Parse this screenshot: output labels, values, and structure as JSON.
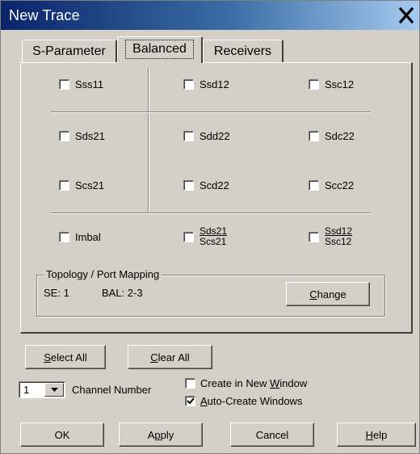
{
  "window": {
    "title": "New Trace"
  },
  "tabs": [
    {
      "label": "S-Parameter",
      "active": false
    },
    {
      "label": "Balanced",
      "active": true
    },
    {
      "label": "Receivers",
      "active": false
    }
  ],
  "params": {
    "sss11": {
      "label": "Sss11",
      "checked": false
    },
    "ssd12": {
      "label": "Ssd12",
      "checked": false
    },
    "ssc12": {
      "label": "Ssc12",
      "checked": false
    },
    "sds21": {
      "label": "Sds21",
      "checked": false
    },
    "sdd22": {
      "label": "Sdd22",
      "checked": false
    },
    "sdc22": {
      "label": "Sdc22",
      "checked": false
    },
    "scs21": {
      "label": "Scs21",
      "checked": false
    },
    "scd22": {
      "label": "Scd22",
      "checked": false
    },
    "scc22": {
      "label": "Scc22",
      "checked": false
    },
    "imbal": {
      "label": "Imbal",
      "checked": false
    },
    "ratio1": {
      "numerator": "Sds21",
      "denominator": "Scs21",
      "checked": false
    },
    "ratio2": {
      "numerator": "Ssd12",
      "denominator": "Ssc12",
      "checked": false
    }
  },
  "topology": {
    "group_title": "Topology / Port Mapping",
    "se": "SE: 1",
    "bal": "BAL: 2-3",
    "change_button": {
      "mnemonic": "C",
      "rest": "hange"
    }
  },
  "select_all": {
    "mnemonic": "S",
    "rest": "elect All"
  },
  "clear_all": {
    "mnemonic": "C",
    "rest": "lear All"
  },
  "channel": {
    "value": "1",
    "label": "Channel Number"
  },
  "create_new_window": {
    "prefix": "Create in New ",
    "mnemonic": "W",
    "rest": "indow",
    "checked": false
  },
  "auto_create": {
    "mnemonic": "A",
    "rest": "uto-Create Windows",
    "checked": true
  },
  "buttons": {
    "ok": "OK",
    "apply": {
      "prefix": "A",
      "mnemonic": "p",
      "rest": "ply"
    },
    "cancel": "Cancel",
    "help": {
      "mnemonic": "H",
      "rest": "elp"
    }
  },
  "colors": {
    "face": "#d4d0c8",
    "title_start": "#0a246a",
    "title_end": "#a6caf0",
    "shadow": "#808080",
    "highlight": "#ffffff"
  }
}
